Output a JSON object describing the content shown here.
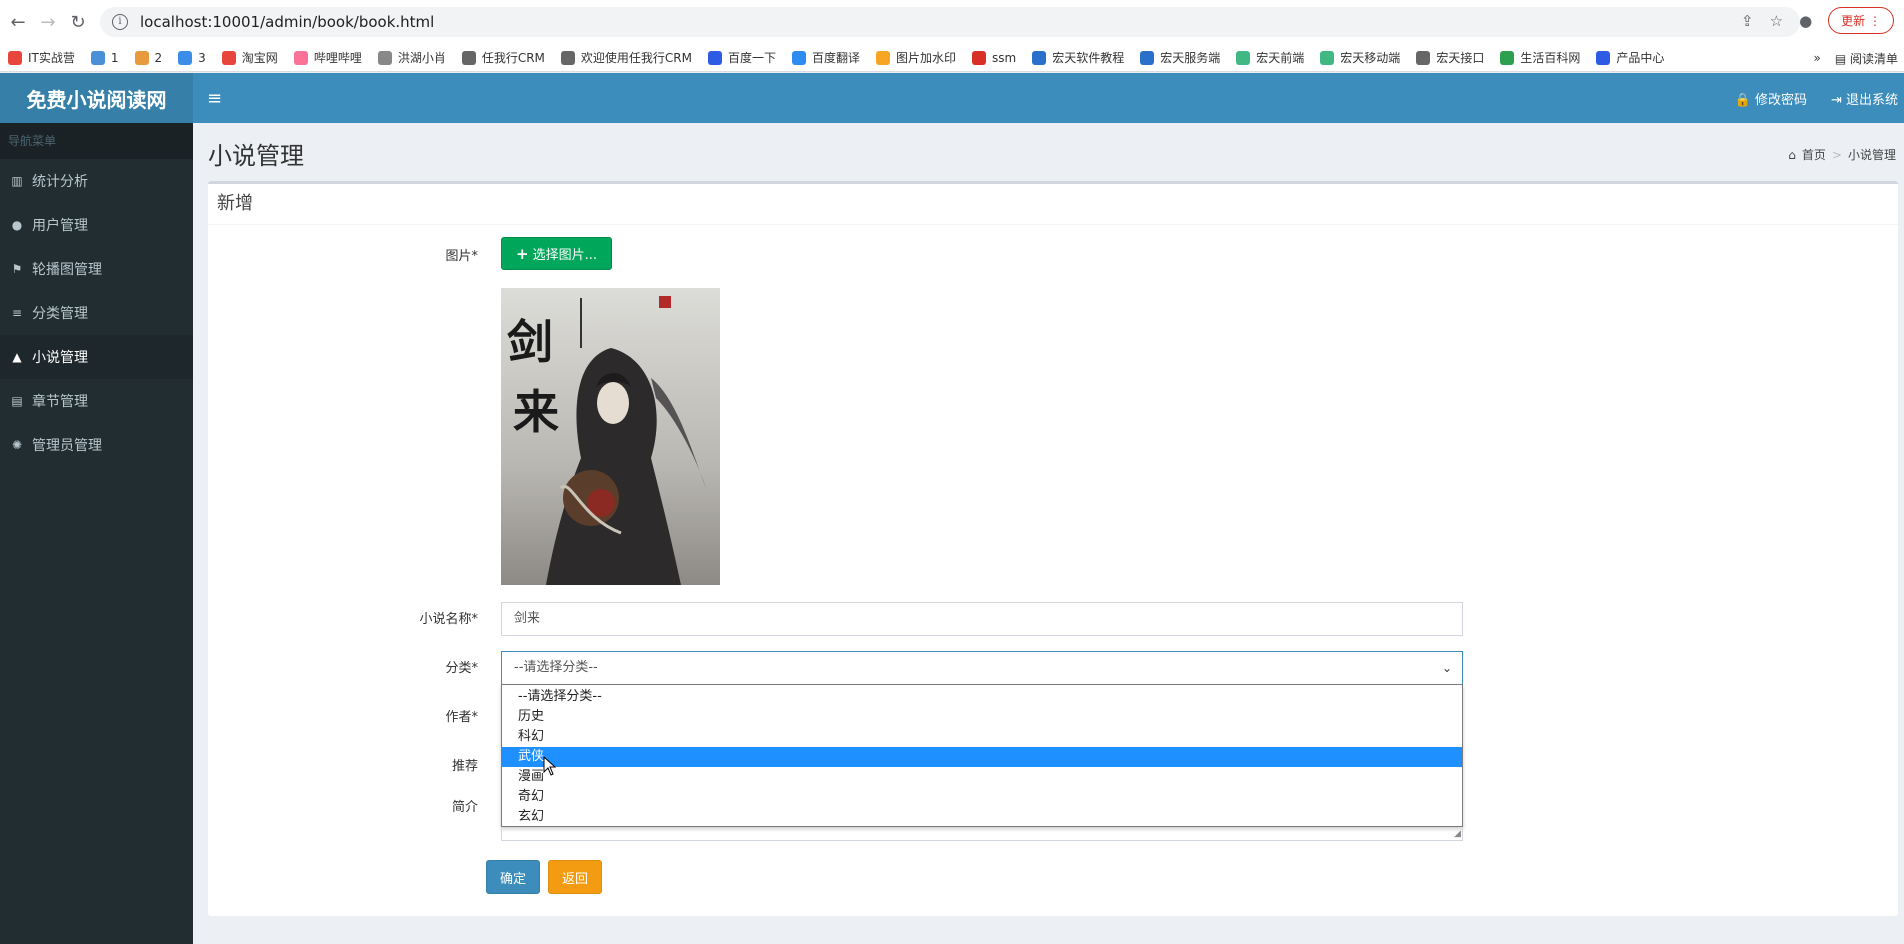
{
  "browser": {
    "url": "localhost:10001/admin/book/book.html",
    "update_label": "更新",
    "bookmarks": [
      "IT实战营",
      "1",
      "2",
      "3",
      "淘宝网",
      "哔哩哔哩",
      "洪湖小肖",
      "任我行CRM",
      "欢迎使用任我行CRM",
      "百度一下",
      "百度翻译",
      "图片加水印",
      "ssm",
      "宏天软件教程",
      "宏天服务端",
      "宏天前端",
      "宏天移动端",
      "宏天接口",
      "生活百科网",
      "产品中心"
    ],
    "reading_list": "阅读清单"
  },
  "app": {
    "brand": "免费小说阅读网",
    "change_password": "修改密码",
    "logout": "退出系统"
  },
  "sidebar": {
    "header": "导航菜单",
    "items": [
      {
        "label": "统计分析",
        "icon": "bar-chart-icon"
      },
      {
        "label": "用户管理",
        "icon": "user-icon"
      },
      {
        "label": "轮播图管理",
        "icon": "flag-icon"
      },
      {
        "label": "分类管理",
        "icon": "list-icon"
      },
      {
        "label": "小说管理",
        "icon": "lock-icon"
      },
      {
        "label": "章节管理",
        "icon": "file-icon"
      },
      {
        "label": "管理员管理",
        "icon": "gear-icon"
      }
    ]
  },
  "page": {
    "title": "小说管理",
    "breadcrumb": [
      "首页",
      "小说管理"
    ],
    "box_title": "新增"
  },
  "form": {
    "image_label": "图片*",
    "select_image_button": "选择图片...",
    "name_label": "小说名称*",
    "name_value": "剑来",
    "category_label": "分类*",
    "category_value": "--请选择分类--",
    "author_label": "作者*",
    "recommend_label": "推荐",
    "intro_label": "简介",
    "category_options": [
      "--请选择分类--",
      "历史",
      "科幻",
      "武侠",
      "漫画",
      "奇幻",
      "玄幻"
    ],
    "highlighted_option": "武侠",
    "cover_title": "剑来",
    "ok_button": "确定",
    "back_button": "返回"
  }
}
